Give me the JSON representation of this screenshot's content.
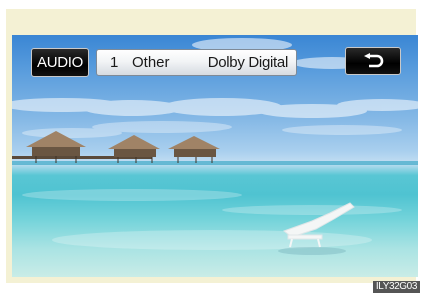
{
  "osd": {
    "audio_button_label": "AUDIO",
    "track_number": "1",
    "audio_language": "Other",
    "audio_format": "Dolby Digital"
  },
  "back_button": {
    "icon": "return-arrow-icon"
  },
  "figure_code": "ILY32G03",
  "colors": {
    "frame_background": "#f4f1d4",
    "button_background": "#000000",
    "info_bar_background": "#eef0f3"
  }
}
